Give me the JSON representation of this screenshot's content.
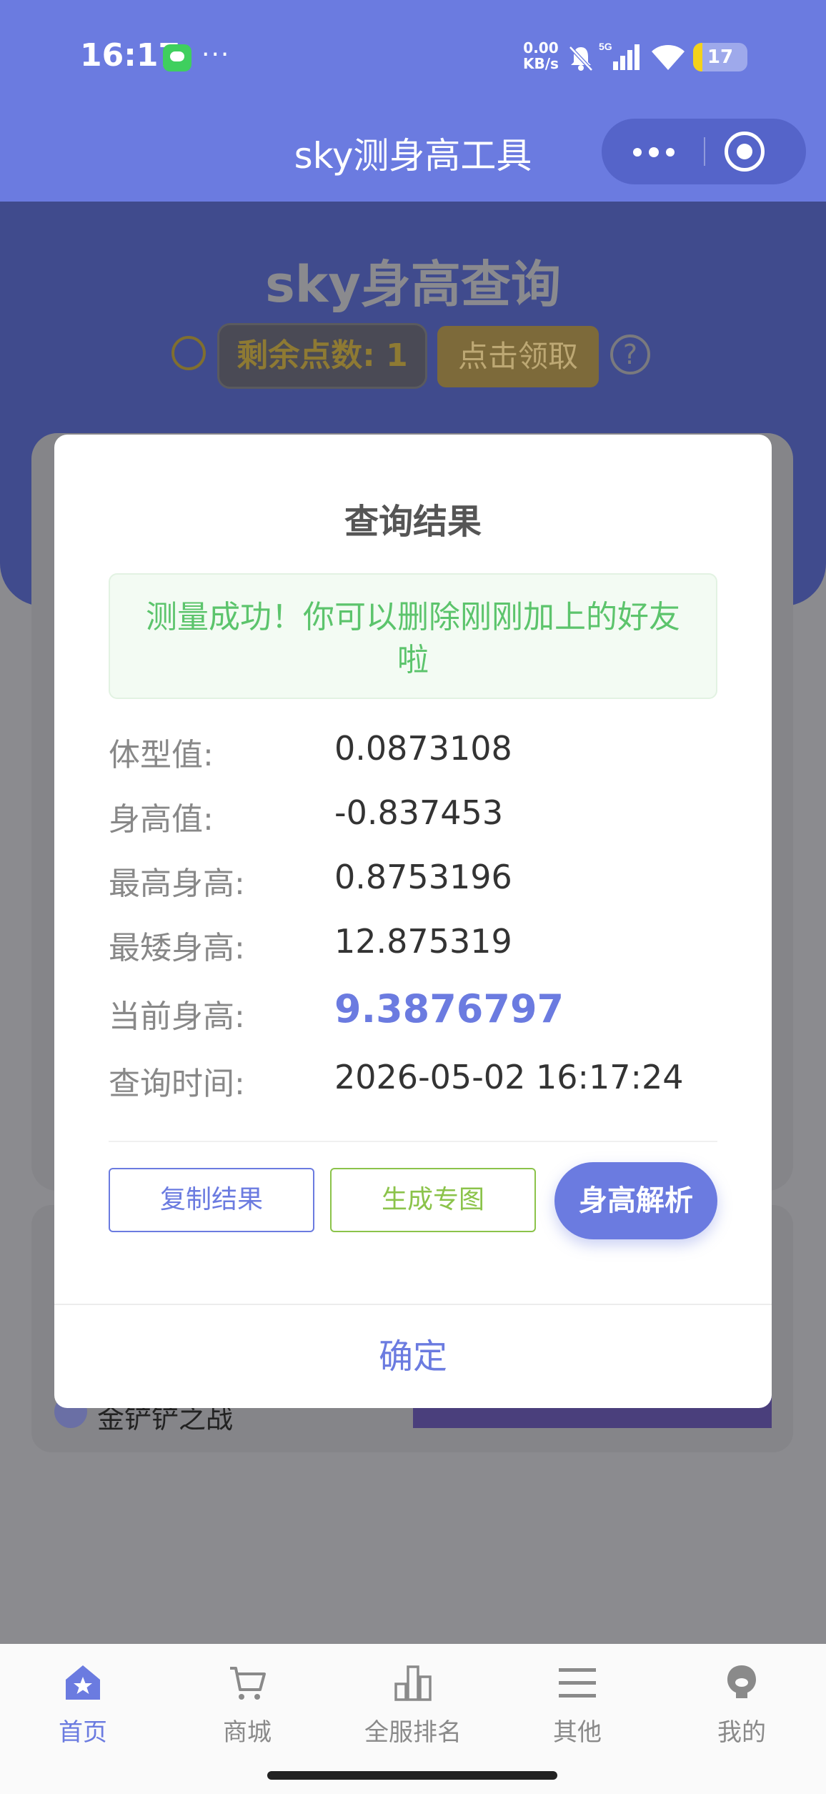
{
  "status_bar": {
    "time": "16:17",
    "dots": "···",
    "net_speed_value": "0.00",
    "net_speed_unit": "KB/s",
    "network": "5G",
    "battery": "17",
    "battery_fraction": 0.17,
    "battery_color": "#f4d21a"
  },
  "title_bar": {
    "title": "sky测身高工具"
  },
  "background_page": {
    "hero_title": "sky身高查询",
    "points_label": "剩余点数: 1",
    "claim_button": "点击领取",
    "help_icon": "?",
    "caption": "金铲铲之战"
  },
  "modal": {
    "title": "查询结果",
    "success_message": "测量成功！你可以删除刚刚加上的好友啦",
    "rows": [
      {
        "label": "体型值:",
        "value": "0.0873108"
      },
      {
        "label": "身高值:",
        "value": "-0.837453"
      },
      {
        "label": "最高身高:",
        "value": "0.8753196"
      },
      {
        "label": "最矮身高:",
        "value": "12.875319"
      },
      {
        "label": "当前身高:",
        "value": "9.3876797"
      },
      {
        "label": "查询时间:",
        "value": "2026-05-02 16:17:24"
      }
    ],
    "buttons": {
      "copy": "复制结果",
      "generate": "生成专图",
      "analyze": "身高解析"
    },
    "confirm": "确定"
  },
  "tabbar": {
    "items": [
      {
        "label": "首页",
        "icon": "home-star-icon",
        "active": true
      },
      {
        "label": "商城",
        "icon": "cart-icon",
        "active": false
      },
      {
        "label": "全服排名",
        "icon": "bar-chart-icon",
        "active": false
      },
      {
        "label": "其他",
        "icon": "menu-icon",
        "active": false
      },
      {
        "label": "我的",
        "icon": "user-icon",
        "active": false
      }
    ]
  },
  "colors": {
    "accent": "#6b7be0",
    "success": "#5cc46c",
    "generate": "#8bc34a"
  }
}
